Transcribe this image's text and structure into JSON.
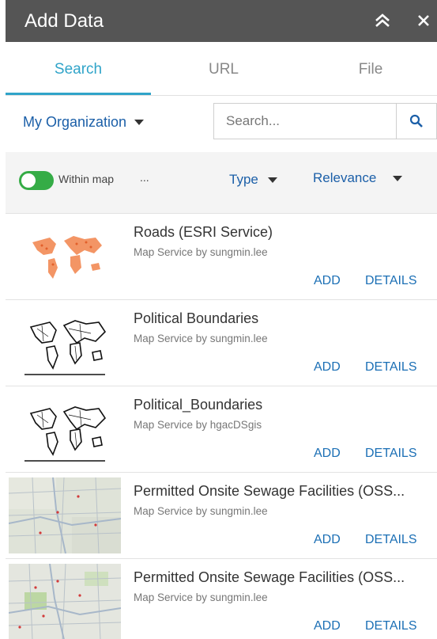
{
  "window": {
    "title": "Add Data"
  },
  "tabs": [
    {
      "label": "Search",
      "active": true
    },
    {
      "label": "URL",
      "active": false
    },
    {
      "label": "File",
      "active": false
    }
  ],
  "scope": {
    "selected": "My Organization"
  },
  "search": {
    "placeholder": "Search...",
    "value": ""
  },
  "filters": {
    "within_map_label": "Within map",
    "within_map_on": true,
    "more": "...",
    "type_label": "Type",
    "sort_label": "Relevance"
  },
  "results": [
    {
      "title": "Roads (ESRI Service)",
      "subtitle": "Map Service by sungmin.lee",
      "thumb": "world-map-orange",
      "add": "ADD",
      "details": "DETAILS"
    },
    {
      "title": "Political Boundaries",
      "subtitle": "Map Service by sungmin.lee",
      "thumb": "world-map-outline",
      "add": "ADD",
      "details": "DETAILS"
    },
    {
      "title": "Political_Boundaries",
      "subtitle": "Map Service by hgacDSgis",
      "thumb": "world-map-outline",
      "add": "ADD",
      "details": "DETAILS"
    },
    {
      "title": "Permitted Onsite Sewage Facilities (OSS...",
      "subtitle": "Map Service by sungmin.lee",
      "thumb": "street-map",
      "add": "ADD",
      "details": "DETAILS"
    },
    {
      "title": "Permitted Onsite Sewage Facilities (OSS...",
      "subtitle": "Map Service by sungmin.lee",
      "thumb": "street-map-green",
      "add": "ADD",
      "details": "DETAILS"
    }
  ],
  "colors": {
    "accent": "#30a4c9",
    "link": "#1b5fa8",
    "toggle_on": "#35ac46",
    "titlebar": "#555555"
  }
}
